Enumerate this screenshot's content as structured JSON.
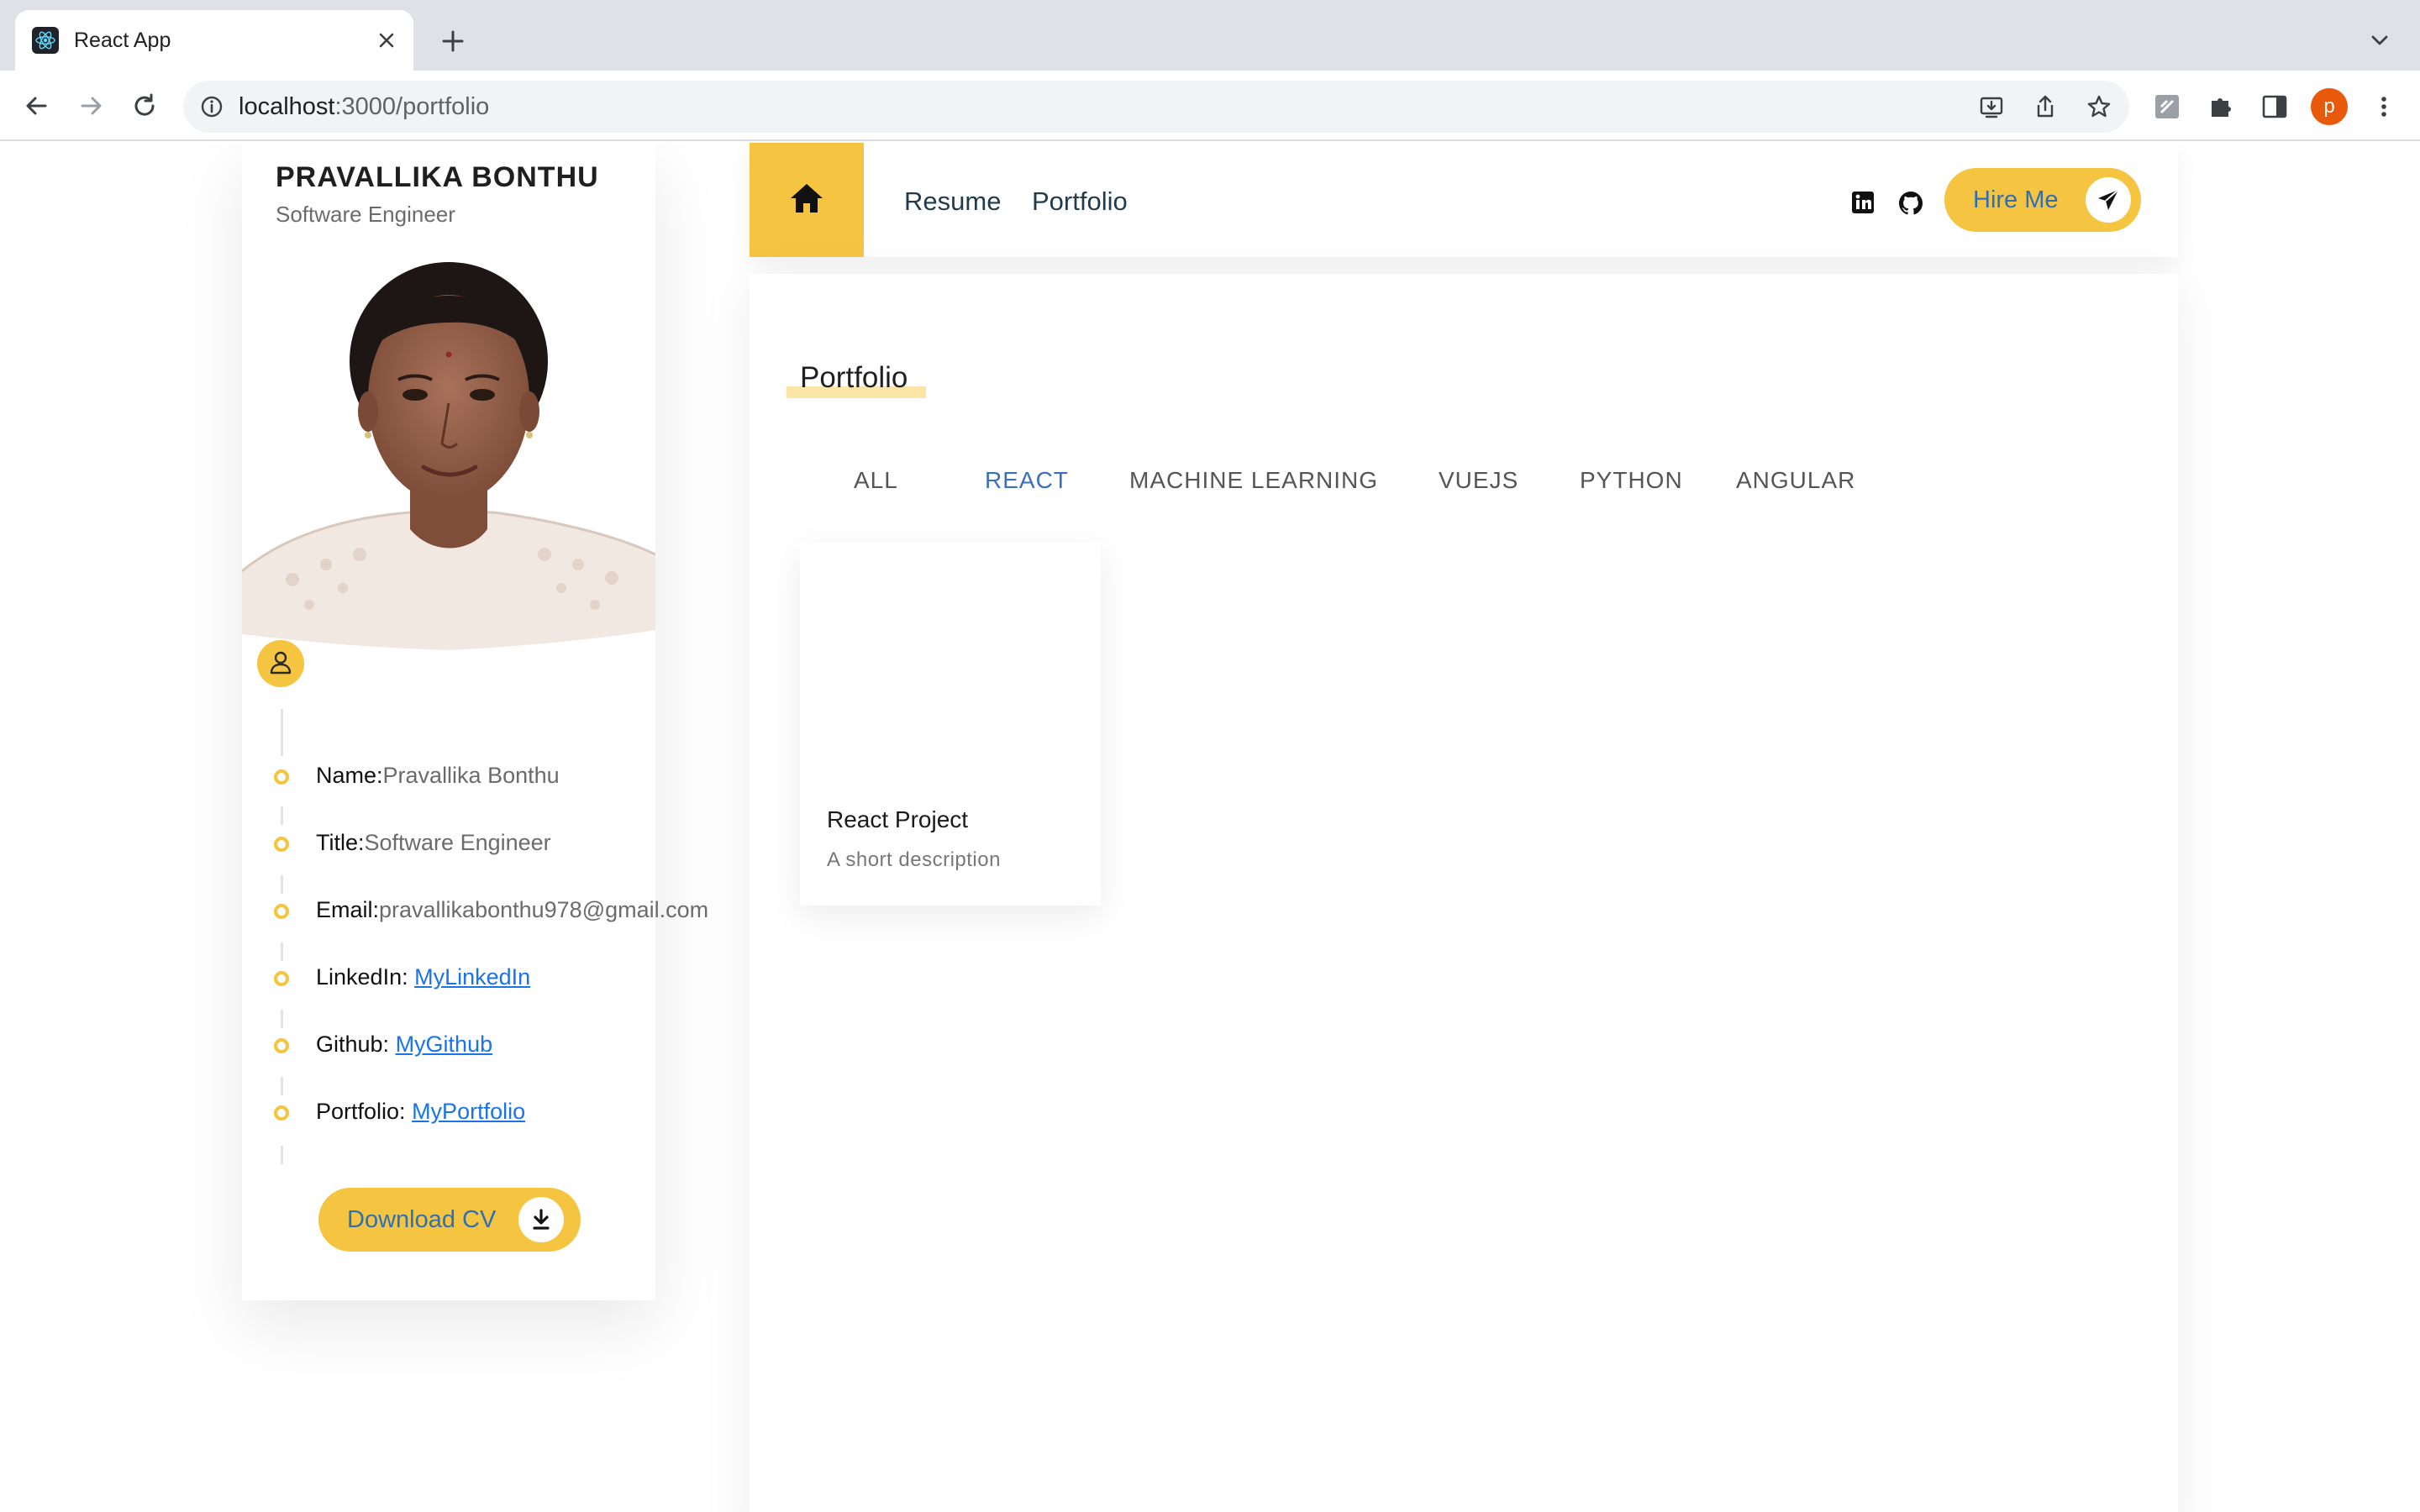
{
  "browser": {
    "tab_title": "React App",
    "url_host": "localhost",
    "url_rest": ":3000/portfolio",
    "profile_initial": "p"
  },
  "profile": {
    "name": "PRAVALLIKA BONTHU",
    "title": "Software Engineer",
    "info": [
      {
        "label": "Name:",
        "value": "Pravallika Bonthu"
      },
      {
        "label": "Title:",
        "value": "Software Engineer"
      },
      {
        "label": "Email:",
        "value": "pravallikabonthu978@gmail.com"
      },
      {
        "label": "LinkedIn: ",
        "link": "MyLinkedIn"
      },
      {
        "label": "Github: ",
        "link": "MyGithub"
      },
      {
        "label": "Portfolio: ",
        "link": "MyPortfolio"
      }
    ],
    "download_label": "Download CV"
  },
  "header": {
    "nav": [
      "Resume",
      "Portfolio"
    ],
    "hire_label": "Hire Me"
  },
  "portfolio": {
    "section_title": "Portfolio",
    "tabs": [
      "ALL",
      "REACT",
      "MACHINE LEARNING",
      "VUEJS",
      "PYTHON",
      "ANGULAR"
    ],
    "active_tab": "REACT",
    "projects": [
      {
        "title": "React Project",
        "description": "A short description"
      }
    ]
  },
  "colors": {
    "accent": "#f5c542",
    "link": "#1a73e8",
    "active_tab": "#3b6fb8"
  }
}
